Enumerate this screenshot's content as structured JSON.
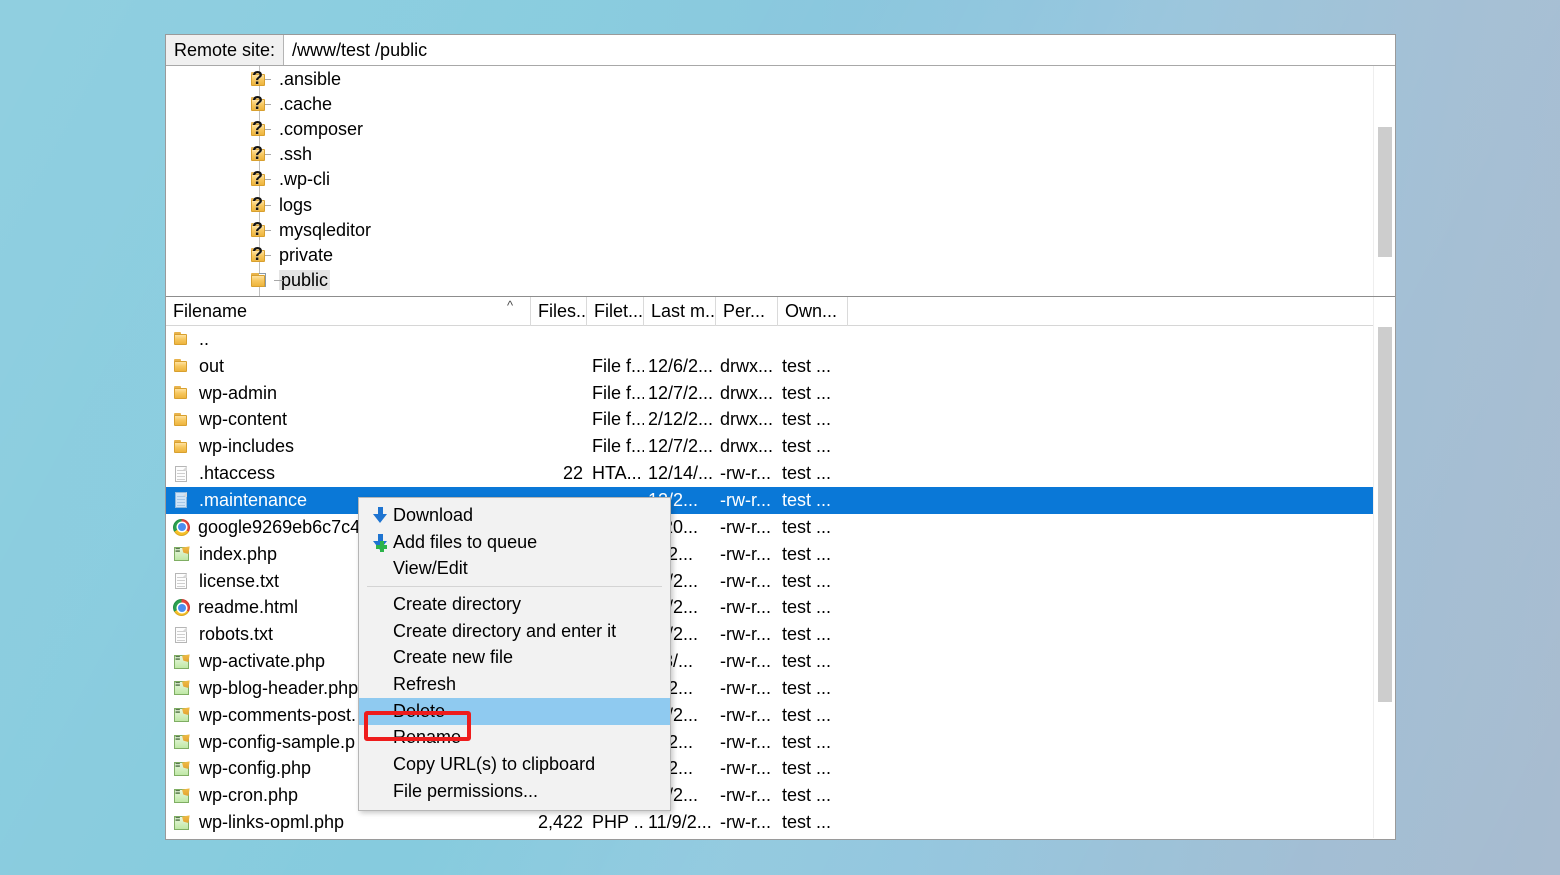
{
  "window": {
    "remote_site_label": "Remote site:",
    "remote_site_path": "/www/test /public"
  },
  "tree": {
    "items": [
      {
        "label": ".ansible",
        "icon": "unknown-folder-icon",
        "expander": false,
        "selected": false
      },
      {
        "label": ".cache",
        "icon": "unknown-folder-icon",
        "expander": false,
        "selected": false
      },
      {
        "label": ".composer",
        "icon": "unknown-folder-icon",
        "expander": false,
        "selected": false
      },
      {
        "label": ".ssh",
        "icon": "unknown-folder-icon",
        "expander": false,
        "selected": false
      },
      {
        "label": ".wp-cli",
        "icon": "unknown-folder-icon",
        "expander": false,
        "selected": false
      },
      {
        "label": "logs",
        "icon": "unknown-folder-icon",
        "expander": false,
        "selected": false
      },
      {
        "label": "mysqleditor",
        "icon": "unknown-folder-icon",
        "expander": false,
        "selected": false
      },
      {
        "label": "private",
        "icon": "unknown-folder-icon",
        "expander": false,
        "selected": false
      },
      {
        "label": "public",
        "icon": "folder-icon",
        "expander": true,
        "selected": true
      }
    ]
  },
  "file_list": {
    "columns": [
      {
        "key": "name",
        "label": "Filename",
        "sort": "ascending"
      },
      {
        "key": "size",
        "label": "Files..."
      },
      {
        "key": "type",
        "label": "Filet..."
      },
      {
        "key": "mod",
        "label": "Last m..."
      },
      {
        "key": "perm",
        "label": "Per..."
      },
      {
        "key": "own",
        "label": "Own..."
      }
    ],
    "rows": [
      {
        "icon": "folder-icon",
        "name": "..",
        "size": "",
        "type": "",
        "mod": "",
        "perm": "",
        "own": "",
        "selected": false
      },
      {
        "icon": "folder-icon",
        "name": "out",
        "size": "",
        "type": "File f...",
        "mod": "12/6/2...",
        "perm": "drwx...",
        "own": "test ...",
        "selected": false
      },
      {
        "icon": "folder-icon",
        "name": "wp-admin",
        "size": "",
        "type": "File f...",
        "mod": "12/7/2...",
        "perm": "drwx...",
        "own": "test ...",
        "selected": false
      },
      {
        "icon": "folder-icon",
        "name": "wp-content",
        "size": "",
        "type": "File f...",
        "mod": "2/12/2...",
        "perm": "drwx...",
        "own": "test ...",
        "selected": false
      },
      {
        "icon": "folder-icon",
        "name": "wp-includes",
        "size": "",
        "type": "File f...",
        "mod": "12/7/2...",
        "perm": "drwx...",
        "own": "test ...",
        "selected": false
      },
      {
        "icon": "document-icon",
        "name": ".htaccess",
        "size": "22",
        "type": "HTA...",
        "mod": "12/14/...",
        "perm": "-rw-r...",
        "own": "test ...",
        "selected": false
      },
      {
        "icon": "document-icon-blue",
        "name": ".maintenance",
        "size": "",
        "type": "",
        "mod": "12/2...",
        "perm": "-rw-r...",
        "own": "test ...",
        "selected": true
      },
      {
        "icon": "chrome-icon",
        "name": "google9269eb6c7c4",
        "size": "",
        "type": "",
        "mod": "4/20...",
        "perm": "-rw-r...",
        "own": "test ...",
        "selected": false
      },
      {
        "icon": "php-icon",
        "name": "index.php",
        "size": "",
        "type": "",
        "mod": "/9/2...",
        "perm": "-rw-r...",
        "own": "test ...",
        "selected": false
      },
      {
        "icon": "document-icon",
        "name": "license.txt",
        "size": "",
        "type": "",
        "mod": "10/2...",
        "perm": "-rw-r...",
        "own": "test ...",
        "selected": false
      },
      {
        "icon": "chrome-icon",
        "name": "readme.html",
        "size": "",
        "type": "",
        "mod": "10/2...",
        "perm": "-rw-r...",
        "own": "test ...",
        "selected": false
      },
      {
        "icon": "document-icon",
        "name": "robots.txt",
        "size": "",
        "type": "",
        "mod": "23/2...",
        "perm": "-rw-r...",
        "own": "test ...",
        "selected": false
      },
      {
        "icon": "php-icon",
        "name": "wp-activate.php",
        "size": "",
        "type": "",
        "mod": "/13/...",
        "perm": "-rw-r...",
        "own": "test ...",
        "selected": false
      },
      {
        "icon": "php-icon",
        "name": "wp-blog-header.php",
        "size": "",
        "type": "",
        "mod": "/9/2...",
        "perm": "-rw-r...",
        "own": "test ...",
        "selected": false
      },
      {
        "icon": "php-icon",
        "name": "wp-comments-post.",
        "size": "",
        "type": "",
        "mod": "24/2...",
        "perm": "-rw-r...",
        "own": "test ...",
        "selected": false
      },
      {
        "icon": "php-icon",
        "name": "wp-config-sample.p",
        "size": "",
        "type": "",
        "mod": "/9/2...",
        "perm": "-rw-r...",
        "own": "test ...",
        "selected": false
      },
      {
        "icon": "php-icon",
        "name": "wp-config.php",
        "size": "",
        "type": "",
        "mod": "/9/2...",
        "perm": "-rw-r...",
        "own": "test ...",
        "selected": false
      },
      {
        "icon": "php-icon",
        "name": "wp-cron.php",
        "size": "",
        "type": "",
        "mod": "25/2...",
        "perm": "-rw-r...",
        "own": "test ...",
        "selected": false
      },
      {
        "icon": "php-icon",
        "name": "wp-links-opml.php",
        "size": "2,422",
        "type": "PHP ...",
        "mod": "11/9/2...",
        "perm": "-rw-r...",
        "own": "test ...",
        "selected": false
      }
    ]
  },
  "context_menu": {
    "items": [
      {
        "label": "Download",
        "icon": "download-arrow-icon",
        "highlighted": false,
        "separator_after": false
      },
      {
        "label": "Add files to queue",
        "icon": "add-to-queue-icon",
        "highlighted": false,
        "separator_after": false
      },
      {
        "label": "View/Edit",
        "icon": "none",
        "highlighted": false,
        "separator_after": true
      },
      {
        "label": "Create directory",
        "icon": "none",
        "highlighted": false,
        "separator_after": false
      },
      {
        "label": "Create directory and enter it",
        "icon": "none",
        "highlighted": false,
        "separator_after": false
      },
      {
        "label": "Create new file",
        "icon": "none",
        "highlighted": false,
        "separator_after": false
      },
      {
        "label": "Refresh",
        "icon": "none",
        "highlighted": false,
        "separator_after": false
      },
      {
        "label": "Delete",
        "icon": "none",
        "highlighted": true,
        "separator_after": false
      },
      {
        "label": "Rename",
        "icon": "none",
        "highlighted": false,
        "separator_after": false
      },
      {
        "label": "Copy URL(s) to clipboard",
        "icon": "none",
        "highlighted": false,
        "separator_after": false
      },
      {
        "label": "File permissions...",
        "icon": "none",
        "highlighted": false,
        "separator_after": false
      }
    ]
  },
  "annotation": {
    "highlight_target": "Delete",
    "color": "#ee1c1c"
  },
  "colors": {
    "desktop_background": "#86cbde",
    "selection_blue": "#0a78d7",
    "menu_highlight": "#8fcaf0",
    "annotation_red": "#ee1c1c"
  }
}
